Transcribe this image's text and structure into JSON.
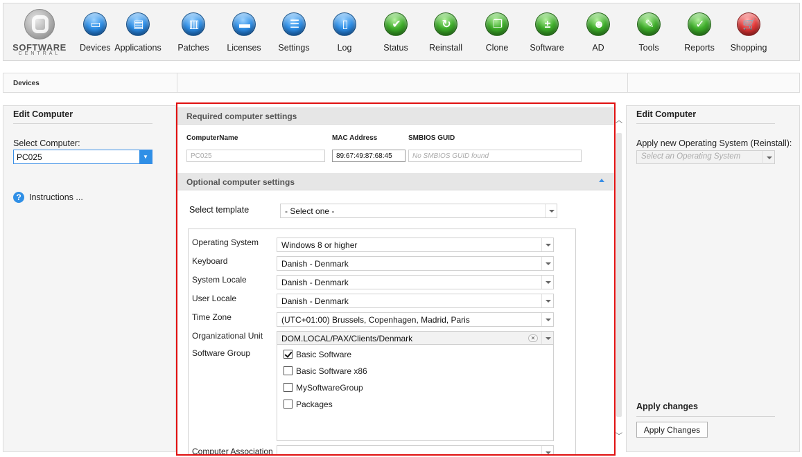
{
  "brand": {
    "line1": "SOFTWARE",
    "line2": "CENTRAL"
  },
  "toolbar": [
    {
      "label": "Devices",
      "icon": "monitor-icon",
      "color": "blue",
      "glyph": "▭"
    },
    {
      "label": "Applications",
      "icon": "applications-icon",
      "color": "blue",
      "glyph": "▤"
    },
    {
      "label": "Patches",
      "icon": "patches-icon",
      "color": "blue",
      "glyph": "▥"
    },
    {
      "label": "Licenses",
      "icon": "licenses-icon",
      "color": "blue",
      "glyph": "▬"
    },
    {
      "label": "Settings",
      "icon": "settings-icon",
      "color": "blue",
      "glyph": "☰"
    },
    {
      "label": "Log",
      "icon": "log-icon",
      "color": "blue",
      "glyph": "▯"
    },
    {
      "label": "Status",
      "icon": "status-check-icon",
      "color": "green",
      "glyph": "✔"
    },
    {
      "label": "Reinstall",
      "icon": "reinstall-icon",
      "color": "green",
      "glyph": "↻"
    },
    {
      "label": "Clone",
      "icon": "clone-icon",
      "color": "green",
      "glyph": "❐"
    },
    {
      "label": "Software",
      "icon": "software-icon",
      "color": "green",
      "glyph": "±"
    },
    {
      "label": "AD",
      "icon": "ad-users-icon",
      "color": "green",
      "glyph": "☻"
    },
    {
      "label": "Tools",
      "icon": "tools-wrench-icon",
      "color": "green",
      "glyph": "✎"
    },
    {
      "label": "Reports",
      "icon": "reports-icon",
      "color": "green",
      "glyph": "✓"
    },
    {
      "label": "Shopping",
      "icon": "shopping-cart-icon",
      "color": "red",
      "glyph": "🛒"
    }
  ],
  "breadcrumb": "Devices",
  "left": {
    "title": "Edit Computer",
    "select_label": "Select Computer:",
    "selected_computer": "PC025",
    "instructions": "Instructions ..."
  },
  "center": {
    "required_header": "Required computer settings",
    "fields": {
      "name_label": "ComputerName",
      "name_value": "PC025",
      "mac_label": "MAC Address",
      "mac_value": "89:67:49:87:68:45",
      "guid_label": "SMBIOS GUID",
      "guid_placeholder": "No SMBIOS GUID found"
    },
    "optional_header": "Optional computer settings",
    "template_label": "Select template",
    "template_value": "- Select one -",
    "rows": [
      {
        "label": "Operating System",
        "value": "Windows 8 or higher"
      },
      {
        "label": "Keyboard",
        "value": "Danish - Denmark"
      },
      {
        "label": "System Locale",
        "value": "Danish - Denmark"
      },
      {
        "label": "User Locale",
        "value": "Danish - Denmark"
      },
      {
        "label": "Time Zone",
        "value": "(UTC+01:00) Brussels, Copenhagen, Madrid, Paris"
      },
      {
        "label": "Organizational Unit",
        "value": "DOM.LOCAL/PAX/Clients/Denmark"
      }
    ],
    "software_group_label": "Software Group",
    "software_groups": [
      {
        "label": "Basic Software",
        "checked": true
      },
      {
        "label": "Basic Software x86",
        "checked": false
      },
      {
        "label": "MySoftwareGroup",
        "checked": false
      },
      {
        "label": "Packages",
        "checked": false
      }
    ],
    "association_label": "Computer Association"
  },
  "right": {
    "title": "Edit Computer",
    "os_label": "Apply new Operating System (Reinstall):",
    "os_placeholder": "Select an Operating System",
    "apply_title": "Apply changes",
    "apply_button": "Apply Changes"
  },
  "colors": {
    "accent": "#2f8fe6",
    "highlight_border": "#e01010"
  }
}
